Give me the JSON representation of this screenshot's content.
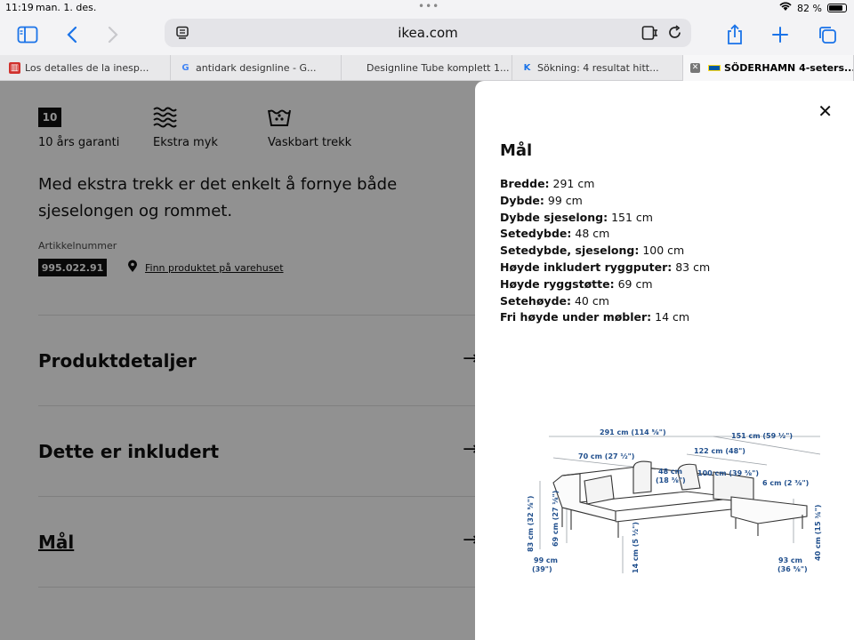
{
  "status": {
    "time": "11:19",
    "date": "man. 1. des.",
    "battery": "82 %",
    "battery_level": 0.82
  },
  "toolbar": {
    "url": "ikea.com"
  },
  "tabs": [
    {
      "title": "Los detalles de la inesp...",
      "fav": "▥",
      "favcolor": "#d0312d"
    },
    {
      "title": "antidark designline - G...",
      "fav": "G",
      "favcolor": "#4285f4"
    },
    {
      "title": "Designline Tube komplett 1...",
      "fav": "",
      "favcolor": "#e8e8ea"
    },
    {
      "title": "Sökning: 4 resultat hitt...",
      "fav": "K",
      "favcolor": "#1a73e8"
    },
    {
      "title": "SÖDERHAMN 4-seters...",
      "fav": "",
      "favcolor": "#0058a3"
    }
  ],
  "features": [
    {
      "icon": "warranty-10-icon",
      "badge": "10",
      "label": "10 års garanti"
    },
    {
      "icon": "extra-soft-icon",
      "label": "Ekstra myk"
    },
    {
      "icon": "washable-icon",
      "label": "Vaskbart trekk"
    }
  ],
  "product": {
    "intro": "Med ekstra trekk er det enkelt å fornye både sjeselongen og rommet.",
    "article_label": "Artikkelnummer",
    "article_number": "995.022.91",
    "store_link": "Finn produktet på varehuset"
  },
  "accordion": [
    {
      "label": "Produktdetaljer"
    },
    {
      "label": "Dette er inkludert"
    },
    {
      "label": "Mål"
    }
  ],
  "panel": {
    "title": "Mål",
    "dimensions": [
      {
        "label": "Bredde:",
        "value": "291 cm"
      },
      {
        "label": "Dybde:",
        "value": "99 cm"
      },
      {
        "label": "Dybde sjeselong:",
        "value": "151 cm"
      },
      {
        "label": "Setedybde:",
        "value": "48 cm"
      },
      {
        "label": "Setedybde, sjeselong:",
        "value": "100 cm"
      },
      {
        "label": "Høyde inkludert ryggputer:",
        "value": "83 cm"
      },
      {
        "label": "Høyde ryggstøtte:",
        "value": "69 cm"
      },
      {
        "label": "Setehøyde:",
        "value": "40 cm"
      },
      {
        "label": "Fri høyde under møbler:",
        "value": "14 cm"
      }
    ],
    "diagram_labels": {
      "width": "291 cm (114 ⅝\")",
      "chaise_depth": "151 cm (59 ½\")",
      "seat_width": "70 cm (27 ½\")",
      "chaise_width": "122 cm (48\")",
      "seat_depth": "48 cm",
      "seat_depth_in": "(18 ⅜\")",
      "chaise_seat": "100 cm (39 ⅜\")",
      "arm": "6 cm (2 ⅜\")",
      "height": "83 cm (32 ⅝\")",
      "back": "69 cm (27 ⅛\")",
      "depth": "99 cm",
      "depth_in": "(39\")",
      "clearance": "14 cm (5 ½\")",
      "chaise_front": "93 cm",
      "chaise_front_in": "(36 ⅝\")",
      "seat_height": "40 cm (15 ¾\")"
    }
  }
}
